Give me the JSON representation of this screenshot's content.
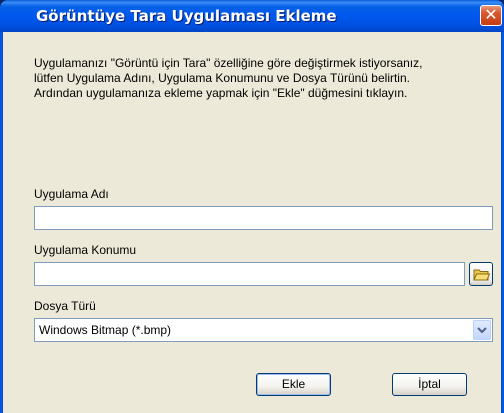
{
  "window": {
    "title": "Görüntüye Tara Uygulaması Ekleme",
    "close_glyph": "✕"
  },
  "description": {
    "lines": [
      "Uygulamanızı \"Görüntü için Tara\" özelliğine göre değiştirmek istiyorsanız,",
      "lütfen Uygulama Adını, Uygulama Konumunu ve Dosya Türünü belirtin.",
      "Ardından uygulamanıza ekleme yapmak için \"Ekle\" düğmesini tıklayın."
    ]
  },
  "fields": {
    "app_name_label": "Uygulama Adı",
    "app_name_value": "",
    "app_location_label": "Uygulama Konumu",
    "app_location_value": "",
    "file_type_label": "Dosya Türü",
    "file_type_value": "Windows Bitmap (*.bmp)"
  },
  "buttons": {
    "add_label": "Ekle",
    "cancel_label": "İptal"
  },
  "icons": {
    "close": "close-icon",
    "browse": "folder-icon",
    "dropdown": "chevron-down-icon"
  },
  "colors": {
    "titlebar": "#0058ee",
    "client_bg": "#ece9d8",
    "close_button": "#d9582f"
  }
}
